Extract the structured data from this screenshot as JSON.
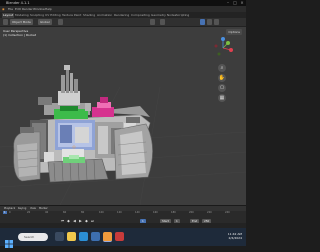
{
  "window": {
    "title": "Blender 4.1.1"
  },
  "menus": [
    "File",
    "Edit",
    "Render",
    "Window",
    "Help"
  ],
  "workspaces": [
    "Layout",
    "Modeling",
    "Sculpting",
    "UV Editing",
    "Texture Paint",
    "Shading",
    "Animation",
    "Rendering",
    "Compositing",
    "Geometry Nodes",
    "Scripting"
  ],
  "header": {
    "mode": "Object Mode",
    "transform": "Global",
    "options": "Options"
  },
  "viewport": {
    "view_label": "User Perspective",
    "collection_label": "(1) Collection | Rocket",
    "object_name": "Rocket"
  },
  "gizmo": {
    "x": "X",
    "y": "Y",
    "z": "Z"
  },
  "timeline": {
    "menu": [
      "Playback",
      "Keying",
      "View",
      "Marker"
    ],
    "ticks": [
      "0",
      "20",
      "40",
      "60",
      "80",
      "100",
      "120",
      "140",
      "160",
      "180",
      "200",
      "220",
      "240"
    ],
    "current_frame": "1",
    "start_label": "Start",
    "start": "1",
    "end_label": "End",
    "end": "250"
  },
  "taskbar": {
    "search_placeholder": "Search",
    "time": "11:42 AM",
    "date": "2/4/2024"
  },
  "colors": {
    "viewport_bg": "#3d3d3d",
    "accent": "#4772b3",
    "magenta": "#d6328f",
    "green": "#3dbb4a"
  }
}
